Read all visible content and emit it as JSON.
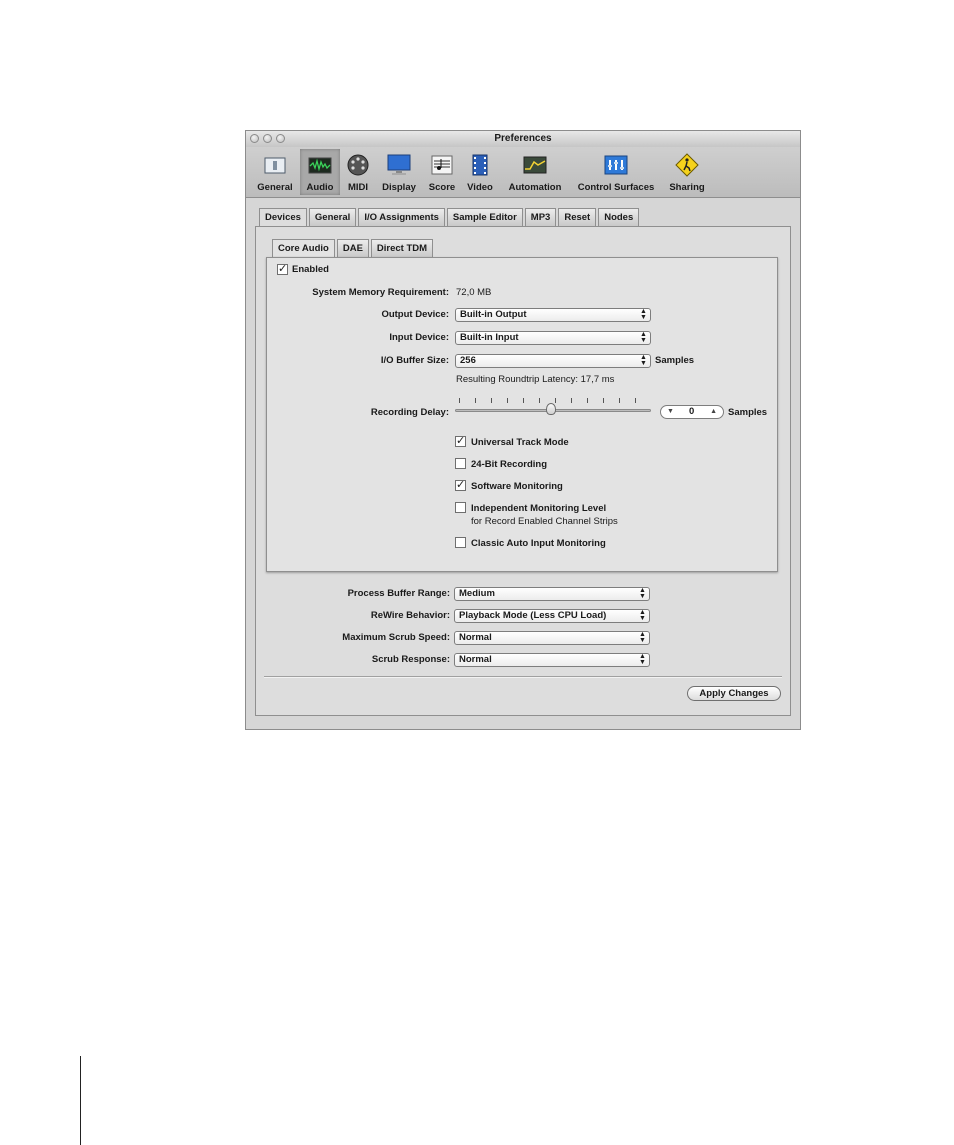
{
  "window": {
    "title": "Preferences"
  },
  "toolbar": {
    "items": [
      {
        "label": "General",
        "icon": "general-icon"
      },
      {
        "label": "Audio",
        "icon": "audio-icon",
        "selected": true
      },
      {
        "label": "MIDI",
        "icon": "midi-icon"
      },
      {
        "label": "Display",
        "icon": "display-icon"
      },
      {
        "label": "Score",
        "icon": "score-icon"
      },
      {
        "label": "Video",
        "icon": "video-icon"
      },
      {
        "label": "Automation",
        "icon": "automation-icon"
      },
      {
        "label": "Control Surfaces",
        "icon": "control-surfaces-icon"
      },
      {
        "label": "Sharing",
        "icon": "sharing-icon"
      }
    ]
  },
  "tabs": [
    "Devices",
    "General",
    "I/O Assignments",
    "Sample Editor",
    "MP3",
    "Reset",
    "Nodes"
  ],
  "subtabs": [
    "Core Audio",
    "DAE",
    "Direct TDM"
  ],
  "core_audio": {
    "enabled_label": "Enabled",
    "enabled": true,
    "memory_label": "System Memory Requirement:",
    "memory_value": "72,0 MB",
    "output_label": "Output Device:",
    "output_value": "Built-in Output",
    "input_label": "Input Device:",
    "input_value": "Built-in Input",
    "buffer_label": "I/O Buffer Size:",
    "buffer_value": "256",
    "buffer_unit": "Samples",
    "latency_text": "Resulting Roundtrip Latency: 17,7 ms",
    "delay_label": "Recording Delay:",
    "delay_value": "0",
    "delay_unit": "Samples",
    "options": {
      "universal": {
        "label": "Universal Track Mode",
        "checked": true
      },
      "bit24": {
        "label": "24-Bit Recording",
        "checked": false
      },
      "software": {
        "label": "Software Monitoring",
        "checked": true
      },
      "independent": {
        "label": "Independent Monitoring Level",
        "sublabel": "for Record Enabled Channel Strips",
        "checked": false
      },
      "classic": {
        "label": "Classic Auto Input Monitoring",
        "checked": false
      }
    }
  },
  "general": {
    "process_label": "Process Buffer Range:",
    "process_value": "Medium",
    "rewire_label": "ReWire Behavior:",
    "rewire_value": "Playback Mode (Less CPU Load)",
    "scrub_speed_label": "Maximum Scrub Speed:",
    "scrub_speed_value": "Normal",
    "scrub_response_label": "Scrub Response:",
    "scrub_response_value": "Normal"
  },
  "apply_label": "Apply Changes",
  "check_mark": "✓"
}
